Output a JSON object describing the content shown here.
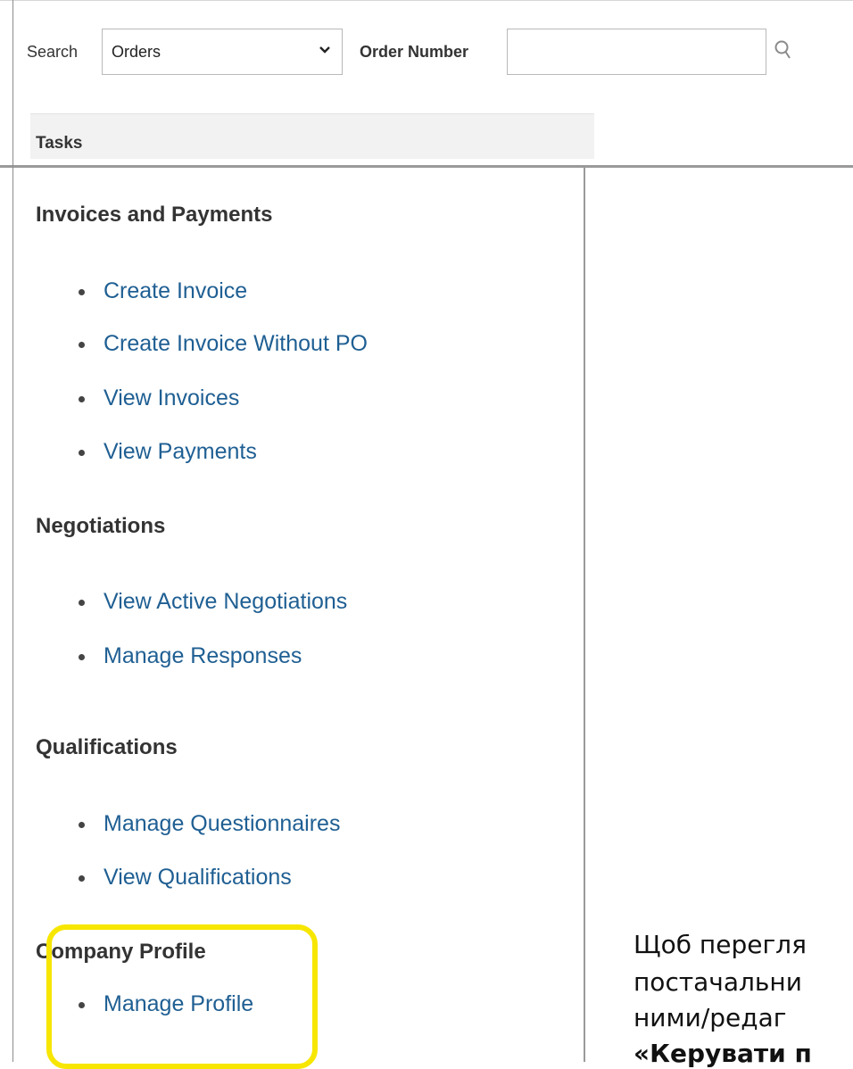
{
  "search": {
    "label": "Search",
    "selected_option": "Orders",
    "order_number_label": "Order Number",
    "order_number_value": ""
  },
  "tasks": {
    "header": "Tasks",
    "sections": [
      {
        "title": "Invoices and Payments",
        "items": [
          "Create Invoice",
          "Create Invoice Without PO",
          "View Invoices",
          "View Payments"
        ]
      },
      {
        "title": "Negotiations",
        "items": [
          "View Active Negotiations",
          "Manage Responses"
        ]
      },
      {
        "title": "Qualifications",
        "items": [
          "Manage Questionnaires",
          "View Qualifications"
        ]
      },
      {
        "title": "Company Profile",
        "items": [
          "Manage Profile"
        ]
      }
    ]
  },
  "annotation": {
    "lines": [
      "Щоб перегля",
      "постачальни",
      "ними/редаг",
      "«Керувати п"
    ],
    "highlight_color": "#f7e600"
  }
}
